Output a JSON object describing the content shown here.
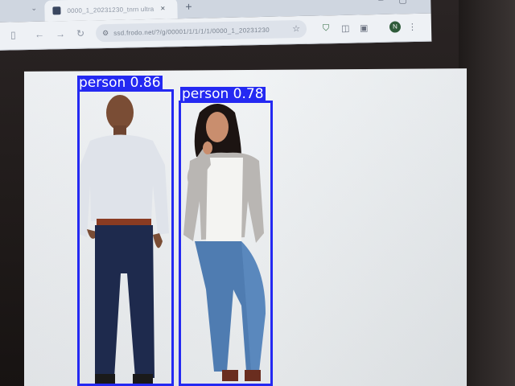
{
  "browser": {
    "tab_title": "0000_1_20231230_tnrn ultra",
    "tab_close": "×",
    "new_tab": "+",
    "url": "ssd.frodo.net/?/g/00001/1/1/1/1/0000_1_20231230",
    "back": "←",
    "forward": "→",
    "reload": "↻",
    "avatar_letter": "N"
  },
  "detections": [
    {
      "label": "person",
      "confidence": "0.86",
      "caption": "person 0.86"
    },
    {
      "label": "person",
      "confidence": "0.78",
      "caption": "person 0.78"
    }
  ],
  "colors": {
    "box": "#2429f2",
    "page_bg": "#eceff1",
    "bezel": "#1f1a19"
  }
}
